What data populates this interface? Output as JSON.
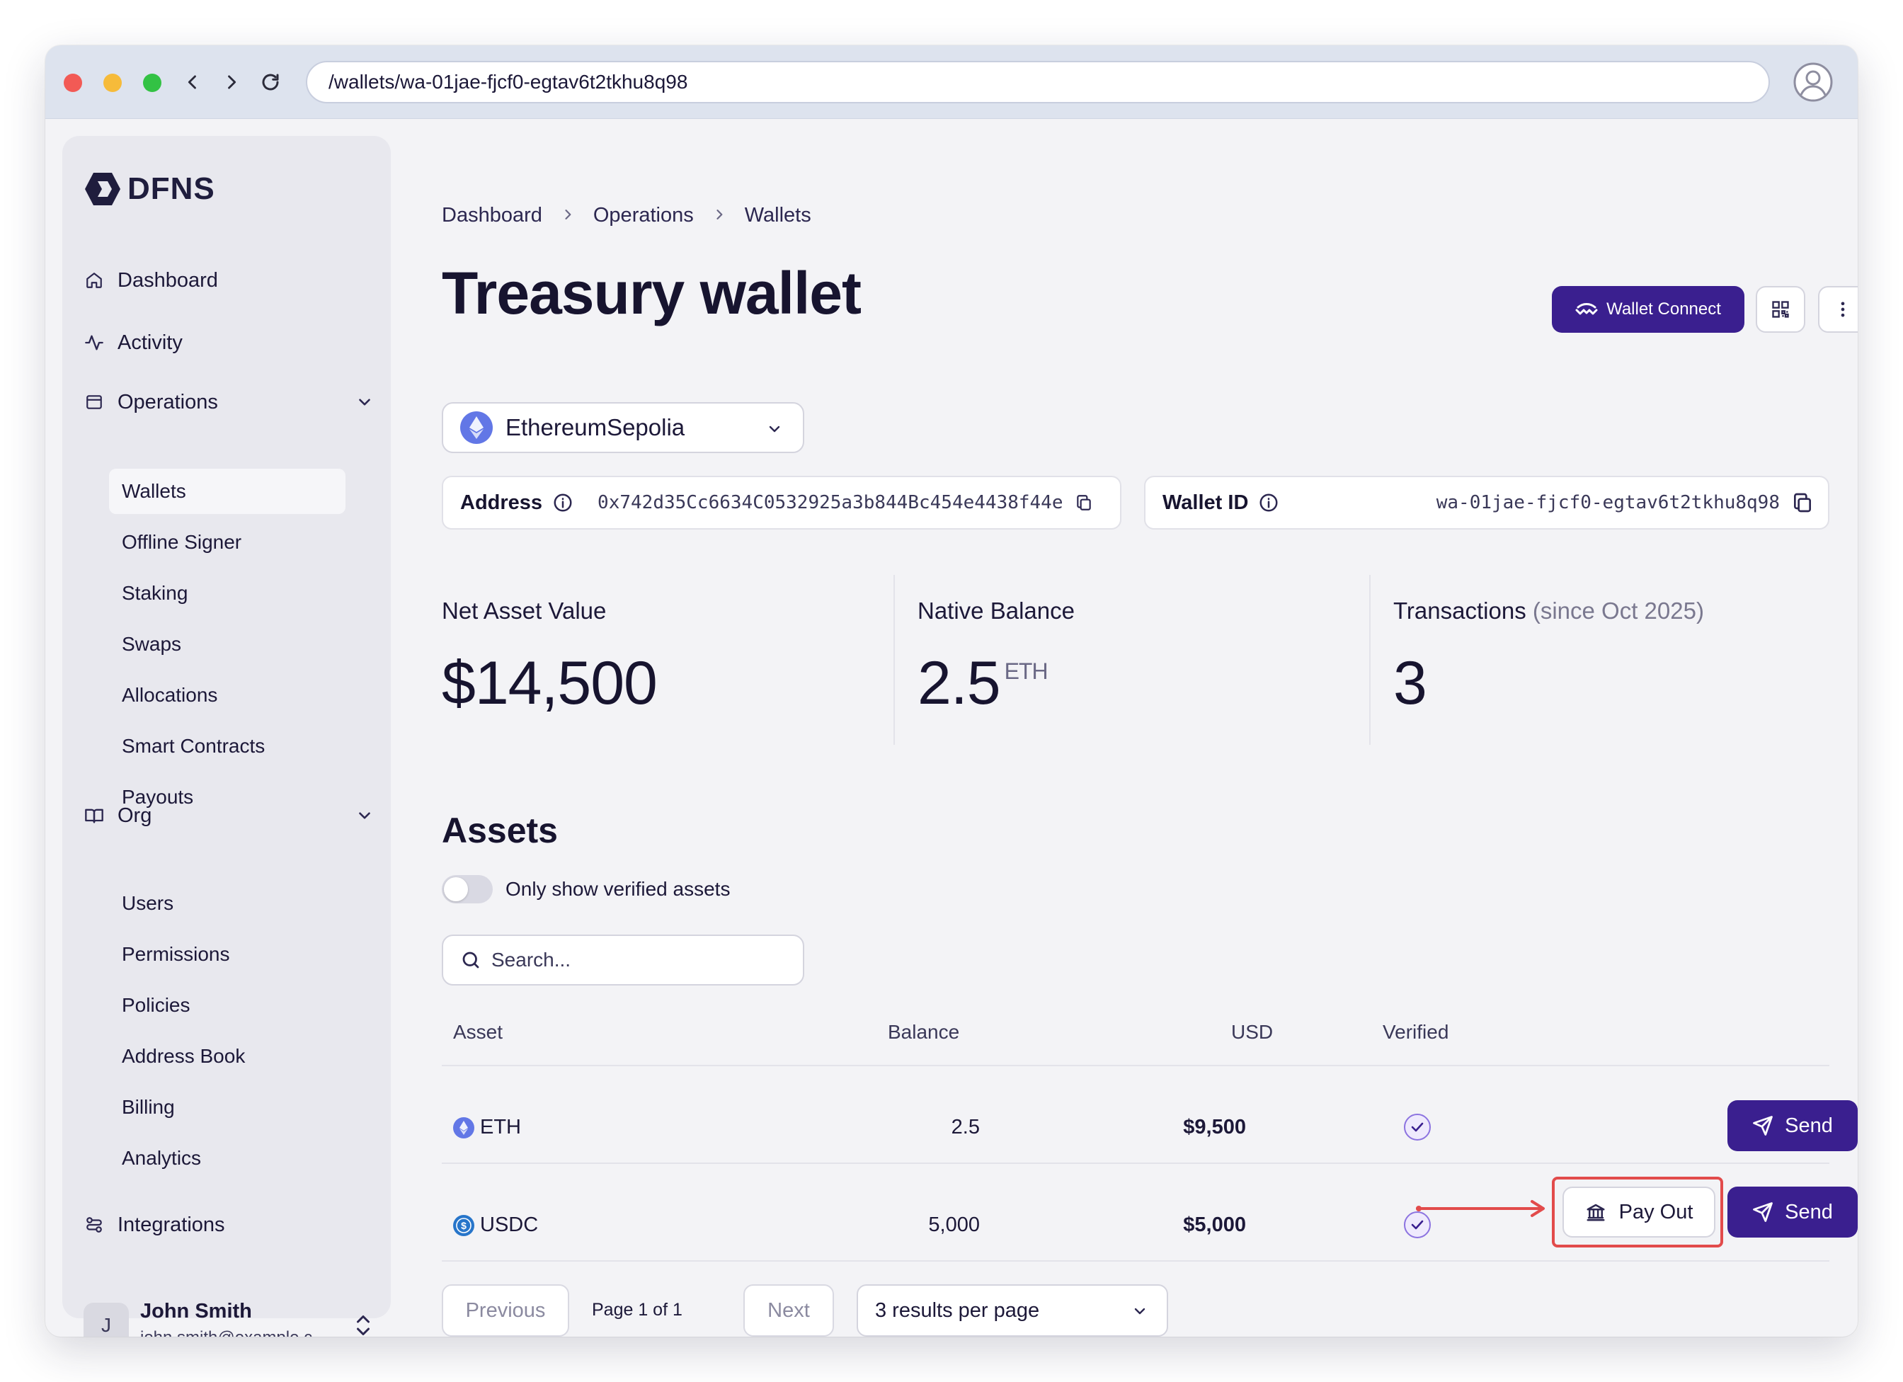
{
  "browser": {
    "url": "/wallets/wa-01jae-fjcf0-egtav6t2tkhu8q98"
  },
  "sidebar": {
    "logo_text": "DFNS",
    "items": {
      "dashboard": "Dashboard",
      "activity": "Activity",
      "operations": "Operations",
      "org": "Org",
      "integrations": "Integrations"
    },
    "operations_sub": [
      "Wallets",
      "Offline Signer",
      "Staking",
      "Swaps",
      "Allocations",
      "Smart Contracts",
      "Payouts"
    ],
    "org_sub": [
      "Users",
      "Permissions",
      "Policies",
      "Address Book",
      "Billing",
      "Analytics"
    ],
    "active_item": "Wallets",
    "user": {
      "initial": "J",
      "name": "John Smith",
      "email": "john.smith@example.c..."
    }
  },
  "breadcrumb": [
    "Dashboard",
    "Operations",
    "Wallets"
  ],
  "page_title": "Treasury wallet",
  "header_actions": {
    "wallet_connect": "Wallet Connect"
  },
  "network": {
    "selected": "EthereumSepolia"
  },
  "address": {
    "label": "Address",
    "value": "0x742d35Cc6634C0532925a3b844Bc454e4438f44e"
  },
  "wallet_id": {
    "label": "Wallet ID",
    "value": "wa-01jae-fjcf0-egtav6t2tkhu8q98"
  },
  "stats": {
    "nav": {
      "label": "Net Asset Value",
      "value": "$14,500"
    },
    "native": {
      "label": "Native Balance",
      "value": "2.5",
      "unit": "ETH"
    },
    "tx": {
      "label": "Transactions",
      "note": "(since Oct 2025)",
      "value": "3"
    }
  },
  "assets": {
    "title": "Assets",
    "toggle_label": "Only show verified assets",
    "toggle_on": false,
    "search_placeholder": "Search...",
    "columns": [
      "Asset",
      "Balance",
      "USD",
      "Verified"
    ],
    "rows": [
      {
        "asset": "ETH",
        "balance": "2.5",
        "usd": "$9,500",
        "verified": true,
        "actions": [
          "Send"
        ]
      },
      {
        "asset": "USDC",
        "balance": "5,000",
        "usd": "$5,000",
        "verified": true,
        "actions": [
          "Pay Out",
          "Send"
        ]
      }
    ],
    "send_label": "Send",
    "payout_label": "Pay Out"
  },
  "pagination": {
    "previous": "Previous",
    "page_text": "Page 1 of 1",
    "next": "Next",
    "per_page": "3 results per page"
  },
  "colors": {
    "primary": "#3a1f8f",
    "highlight": "#e24b4b",
    "background": "#f3f3f6"
  }
}
